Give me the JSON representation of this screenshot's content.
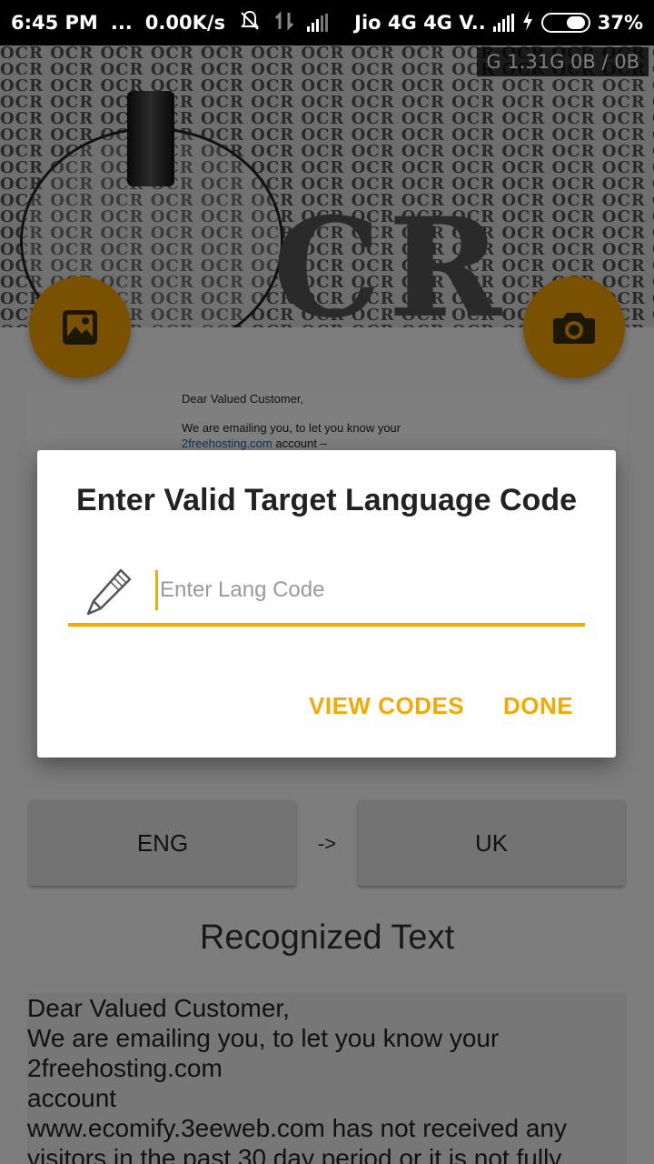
{
  "status_bar": {
    "time": "6:45 PM",
    "dots": "...",
    "speed": "0.00K/s",
    "carrier": "Jio 4G 4G V..",
    "battery": "37%"
  },
  "net_badge": "G 1.31G  0B / 0B",
  "header": {
    "ocr_word": "OCR",
    "big_letters": "CR"
  },
  "preview": {
    "line1": "Dear Valued Customer,",
    "line2": "We are emailing you, to let you know your",
    "link": "2freehosting.com",
    "line3_rest": " account –"
  },
  "dialog": {
    "title": "Enter Valid Target Language Code",
    "input_placeholder": "Enter Lang Code",
    "input_value": "",
    "view_codes": "VIEW CODES",
    "done": "DONE"
  },
  "languages": {
    "source": "ENG",
    "arrow": "->",
    "target": "UK"
  },
  "recognized": {
    "title": "Recognized Text",
    "lines": [
      "Dear Valued Customer,",
      "We are emailing you, to let you know your",
      "2freehosting.com",
      "account",
      "www.ecomify.3eeweb.com has not received any",
      "visitors in the past 30 day period or it is not fully"
    ]
  },
  "colors": {
    "accent": "#f7a800",
    "fab": "#f2a300",
    "scrim": "rgba(0,0,0,0.5)"
  },
  "icons": {
    "gallery": "image-icon",
    "camera": "camera-icon",
    "pencil": "pencil-icon"
  }
}
